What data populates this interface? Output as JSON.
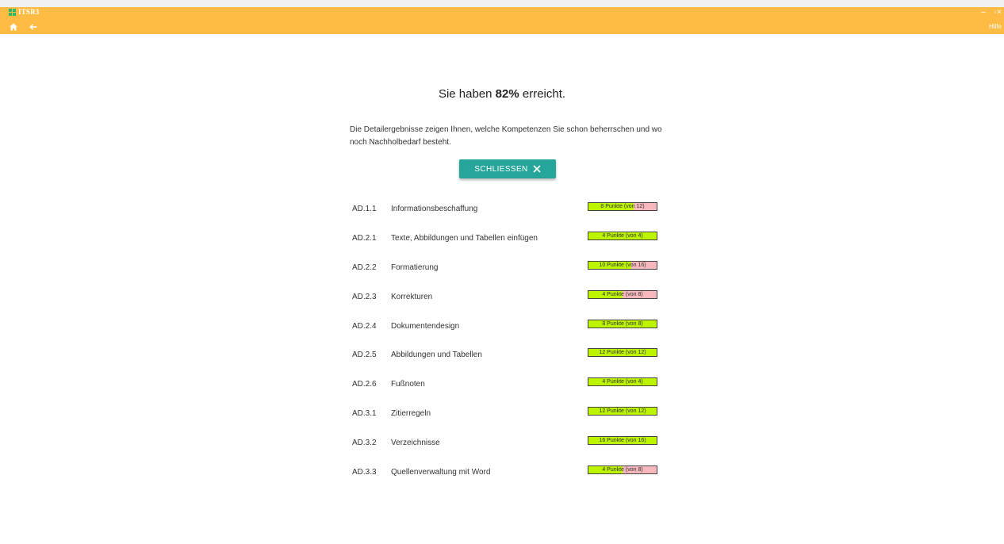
{
  "window": {
    "title": "ITSR3",
    "help_label": "Hilfe",
    "minimize_symbol": "–",
    "restore_symbol": "▫",
    "close_symbol": "×",
    "accent_color": "#ffbc45"
  },
  "result": {
    "prefix": "Sie haben ",
    "percent": "82%",
    "suffix": " erreicht.",
    "intro": "Die Detailergebnisse zeigen Ihnen, welche Kompetenzen Sie schon beherrschen und wo noch Nachholbedarf besteht."
  },
  "close_button": {
    "label": "SCHLIESSEN",
    "icon": "close-icon",
    "color": "#26a69a"
  },
  "score_colors": {
    "achieved": "#bdf400",
    "missing": "#f6b8bc"
  },
  "results": [
    {
      "code": "AD.1.1",
      "topic": "Informationsbeschaffung",
      "points": 8,
      "max": 12,
      "label": "8 Punkte (von 12)"
    },
    {
      "code": "AD.2.1",
      "topic": "Texte, Abbildungen und Tabellen einfügen",
      "points": 4,
      "max": 4,
      "label": "4 Punkte (von 4)"
    },
    {
      "code": "AD.2.2",
      "topic": "Formatierung",
      "points": 10,
      "max": 16,
      "label": "10 Punkte (von 16)"
    },
    {
      "code": "AD.2.3",
      "topic": "Korrekturen",
      "points": 4,
      "max": 8,
      "label": "4 Punkte (von 8)"
    },
    {
      "code": "AD.2.4",
      "topic": "Dokumentendesign",
      "points": 8,
      "max": 8,
      "label": "8 Punkte (von 8)"
    },
    {
      "code": "AD.2.5",
      "topic": "Abbildungen und Tabellen",
      "points": 12,
      "max": 12,
      "label": "12 Punkte (von 12)"
    },
    {
      "code": "AD.2.6",
      "topic": "Fußnoten",
      "points": 4,
      "max": 4,
      "label": "4 Punkte (von 4)"
    },
    {
      "code": "AD.3.1",
      "topic": "Zitierregeln",
      "points": 12,
      "max": 12,
      "label": "12 Punkte (von 12)"
    },
    {
      "code": "AD.3.2",
      "topic": "Verzeichnisse",
      "points": 16,
      "max": 16,
      "label": "16 Punkte (von 16)"
    },
    {
      "code": "AD.3.3",
      "topic": "Quellenverwaltung mit Word",
      "points": 4,
      "max": 8,
      "label": "4 Punkte (von 8)"
    }
  ]
}
